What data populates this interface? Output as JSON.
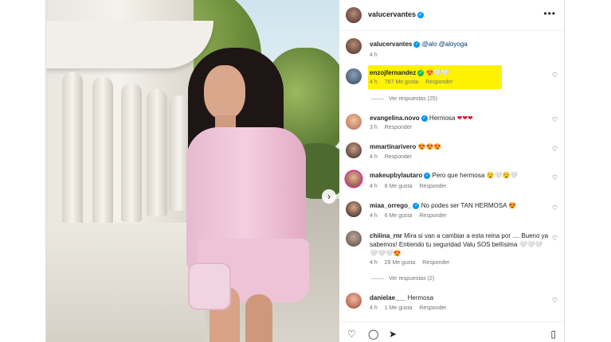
{
  "post": {
    "username": "valucervantes",
    "caption_mentions": "@alo @aloyoga",
    "caption_time": "4 h",
    "more_icon": "more-horizontal-icon"
  },
  "comments": [
    {
      "user": "enzojfernandez",
      "text": "😍🤍🤍",
      "time": "4 h",
      "likes": "787 Me gusta",
      "reply": "Responder",
      "view_replies": "Ver respuestas (25)"
    },
    {
      "user": "evangelina.novo",
      "text": "Hermosa",
      "hearts": "❤❤❤",
      "time": "3 h",
      "reply": "Responder"
    },
    {
      "user": "mmartinarivero",
      "text": "😍😍😍",
      "time": "4 h",
      "reply": "Responder"
    },
    {
      "user": "makeupbylautaro",
      "text": "Pero que hermosa 😯🤍😯🤍",
      "time": "4 h",
      "likes": "8 Me gusta",
      "reply": "Responder"
    },
    {
      "user": "miaa_orrego_",
      "text": "No podes ser TAN HERMOSA 😍",
      "time": "4 h",
      "likes": "6 Me gusta",
      "reply": "Responder"
    },
    {
      "user": "chiiina_rnr",
      "text": "Mira si van a cambiar a esta reina por .... Bueno ya",
      "text2": "sabemos! Entiendo tu seguridad Valu SOS bellísima 🤍🤍🤍",
      "text3": "🤍🤍🤍😍",
      "time": "4 h",
      "likes": "29 Me gusta",
      "reply": "Responder",
      "view_replies": "Ver respuestas (2)"
    },
    {
      "user": "danielae___",
      "text": "Hermosa",
      "time": "4 h",
      "likes": "1 Me gusta",
      "reply": "Responder"
    }
  ],
  "colors": {
    "accent": "#0095f6",
    "highlight": "#fff200",
    "text": "#262626",
    "muted": "#737373"
  }
}
